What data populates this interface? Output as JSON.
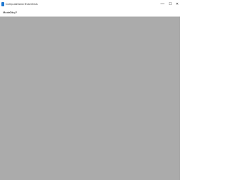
{
  "window": {
    "title": "Computational Essentials",
    "controls": {
      "minimize_glyph": "—",
      "maximize_glyph": "☐",
      "close_glyph": "✕"
    },
    "icon": "app-icon",
    "accent": "#1f78d1"
  },
  "menubar": {
    "items": [
      {
        "label": "Mode"
      },
      {
        "label": "Dbg"
      },
      {
        "label": "?"
      }
    ]
  },
  "content": {
    "background": "#ababab"
  }
}
